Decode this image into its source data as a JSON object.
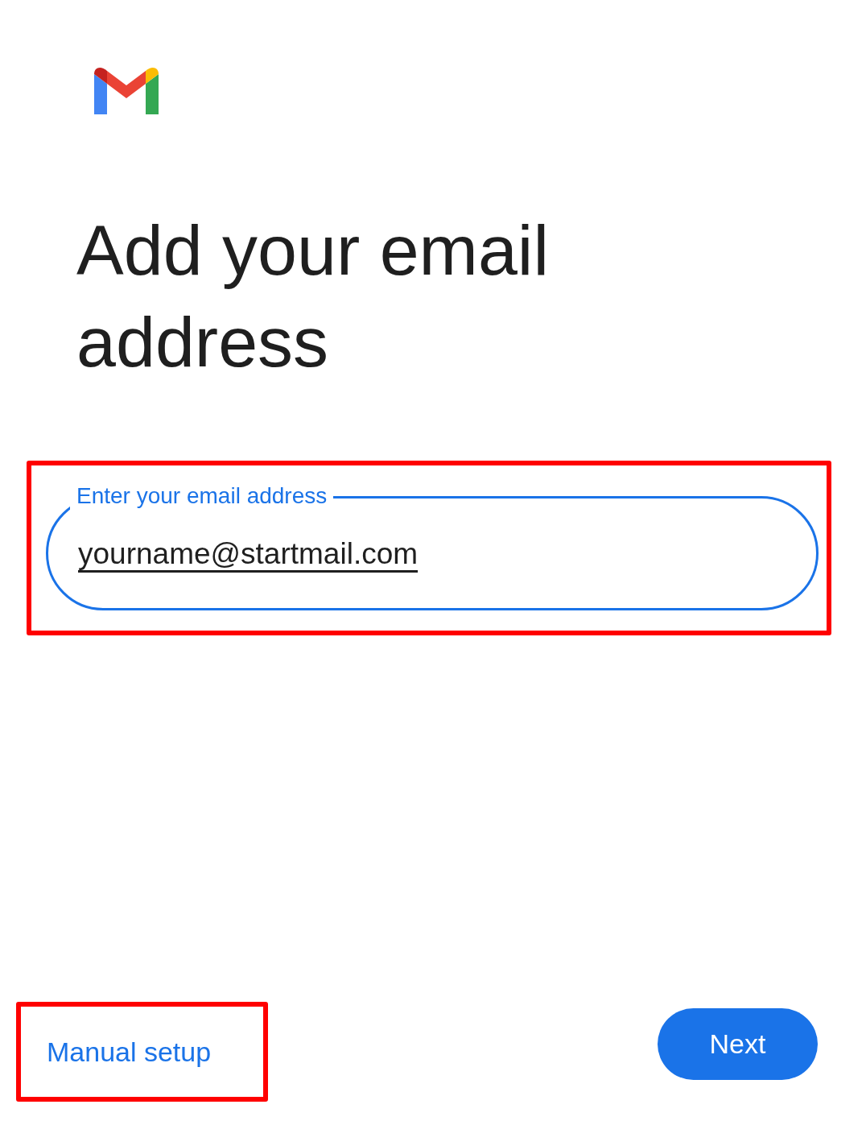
{
  "title": "Add your email address",
  "email_field": {
    "label": "Enter your email address",
    "value": "yourname@startmail.com",
    "focused": true
  },
  "manual_setup": "Manual setup",
  "next_button": "Next"
}
